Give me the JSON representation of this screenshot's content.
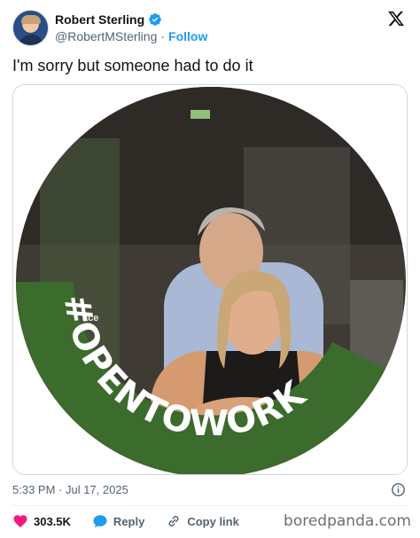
{
  "author": {
    "name": "Robert Sterling",
    "handle": "@RobertMSterling",
    "separator": "·",
    "follow_label": "Follow",
    "avatar_icon": "user-avatar-icon",
    "verified_icon": "verified-badge-icon",
    "verified_color": "#1d9bf0"
  },
  "platform_icon": "x-logo-icon",
  "tweet": {
    "text": "I'm sorry but someone had to do it"
  },
  "media": {
    "frame_text": "#OPENTOWORK",
    "frame_color": "#3b6b2d",
    "background_sign_text": "ace"
  },
  "meta": {
    "timestamp": "5:33 PM · Jul 17, 2025",
    "info_icon": "info-icon"
  },
  "actions": {
    "like_count": "303.5K",
    "like_icon": "heart-icon",
    "like_color": "#f91880",
    "reply_label": "Reply",
    "reply_icon": "speech-bubble-icon",
    "reply_color": "#1d9bf0",
    "copy_label": "Copy link",
    "copy_icon": "link-icon"
  },
  "watermark": "boredpanda.com"
}
